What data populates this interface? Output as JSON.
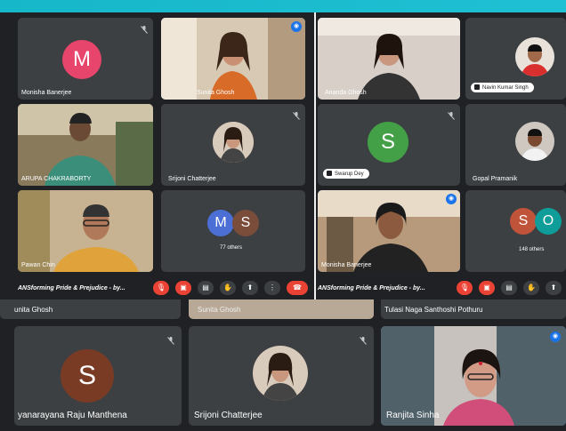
{
  "left_panel": {
    "tiles": [
      {
        "name": "Monisha Banerjee",
        "initial": "M",
        "color": "#e8456c"
      },
      {
        "name": "Sunita Ghosh"
      },
      {
        "name": "ARUPA CHAKRABORTY"
      },
      {
        "name": "Srijoni Chatterjee"
      },
      {
        "name": "Pawan Chin"
      },
      {
        "others": "77 others",
        "initials": [
          "M",
          "S"
        ]
      }
    ],
    "toolbar_title": "ANSforming Pride & Prejudice - by..."
  },
  "right_panel": {
    "tiles": [
      {
        "name": "Ananda Ghosh"
      },
      {
        "name": "Navin Kumar Singh"
      },
      {
        "name": "Swarup Dey",
        "initial": "S",
        "color": "#43a047"
      },
      {
        "name": "Gopal Pramanik"
      },
      {
        "name": "Monisha Banerjee"
      },
      {
        "others": "148 others",
        "initials": [
          "S",
          "O"
        ]
      }
    ],
    "toolbar_title": "ANSforming Pride & Prejudice - by..."
  },
  "bottom": {
    "row1": [
      "unita Ghosh",
      "Sunita Ghosh",
      "Tulasi Naga Santhoshi Pothuru"
    ],
    "tiles": [
      {
        "name": "yanarayana Raju Manthena",
        "initial": "S",
        "color": "#7a3b25"
      },
      {
        "name": "Srijoni Chatterjee"
      },
      {
        "name": "Ranjita Sinha"
      }
    ]
  },
  "icons": [
    "mic-off-icon",
    "camera-off-icon",
    "captions-icon",
    "hand-raise-icon",
    "present-icon",
    "more-icon",
    "end-call-icon"
  ]
}
